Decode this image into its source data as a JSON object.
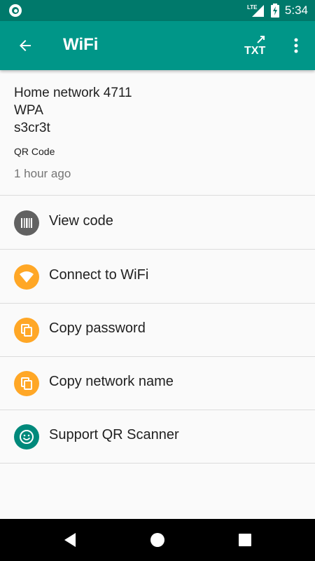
{
  "status_bar": {
    "network": "LTE",
    "time": "5:34"
  },
  "app_bar": {
    "title": "WiFi",
    "txt_label": "TXT"
  },
  "details": {
    "ssid": "Home network 4711",
    "encryption": "WPA",
    "password": "s3cr3t",
    "format": "QR Code",
    "time": "1 hour ago"
  },
  "actions": [
    {
      "label": "View code",
      "icon": "barcode-icon",
      "color": "#616161"
    },
    {
      "label": "Connect to WiFi",
      "icon": "wifi-icon",
      "color": "#ffa726"
    },
    {
      "label": "Copy password",
      "icon": "copy-icon",
      "color": "#ffa726"
    },
    {
      "label": "Copy network name",
      "icon": "copy-icon",
      "color": "#ffa726"
    },
    {
      "label": "Support QR Scanner",
      "icon": "smiley-icon",
      "color": "#00897b"
    }
  ],
  "colors": {
    "primary": "#009688",
    "primary_dark": "#00796b",
    "accent": "#ffa726"
  }
}
